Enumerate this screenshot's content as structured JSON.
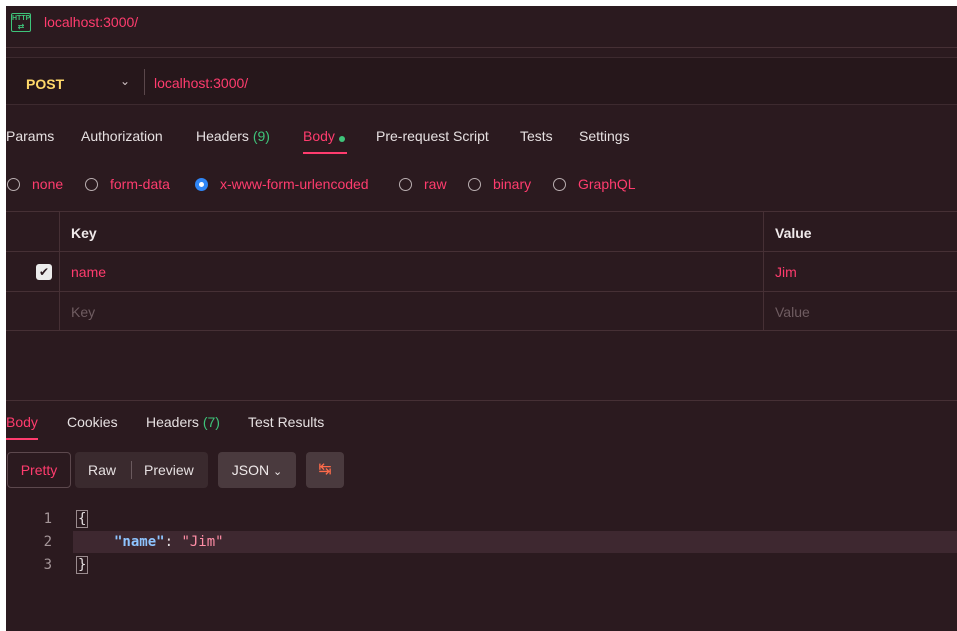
{
  "tab": {
    "icon": "http-icon",
    "title": "localhost:3000/"
  },
  "request": {
    "method": "POST",
    "url": "localhost:3000/",
    "tabs": [
      {
        "label": "Params"
      },
      {
        "label": "Authorization"
      },
      {
        "label": "Headers",
        "count": "(9)"
      },
      {
        "label": "Body"
      },
      {
        "label": "Pre-request Script"
      },
      {
        "label": "Tests"
      },
      {
        "label": "Settings"
      }
    ],
    "active_tab": "Body",
    "body_types": [
      "none",
      "form-data",
      "x-www-form-urlencoded",
      "raw",
      "binary",
      "GraphQL"
    ],
    "selected_body_type": "x-www-form-urlencoded",
    "table": {
      "headers": {
        "key": "Key",
        "value": "Value"
      },
      "rows": [
        {
          "checked": true,
          "key": "name",
          "value": "Jim"
        }
      ],
      "placeholder": {
        "key": "Key",
        "value": "Value"
      }
    }
  },
  "response": {
    "tabs": [
      {
        "label": "Body"
      },
      {
        "label": "Cookies"
      },
      {
        "label": "Headers",
        "count": "(7)"
      },
      {
        "label": "Test Results"
      }
    ],
    "active_tab": "Body",
    "view_modes": [
      "Pretty",
      "Raw",
      "Preview"
    ],
    "active_view": "Pretty",
    "format": "JSON",
    "code_lines": [
      {
        "n": "1",
        "text": "{"
      },
      {
        "n": "2",
        "key": "\"name\"",
        "colon": ": ",
        "value": "\"Jim\""
      },
      {
        "n": "3",
        "text": "}"
      }
    ]
  },
  "colors": {
    "accent": "#ff3c6e",
    "method": "#ffd96a",
    "success": "#3ec47a",
    "radio_selected": "#2f86f6",
    "background": "#2b1a1f"
  }
}
